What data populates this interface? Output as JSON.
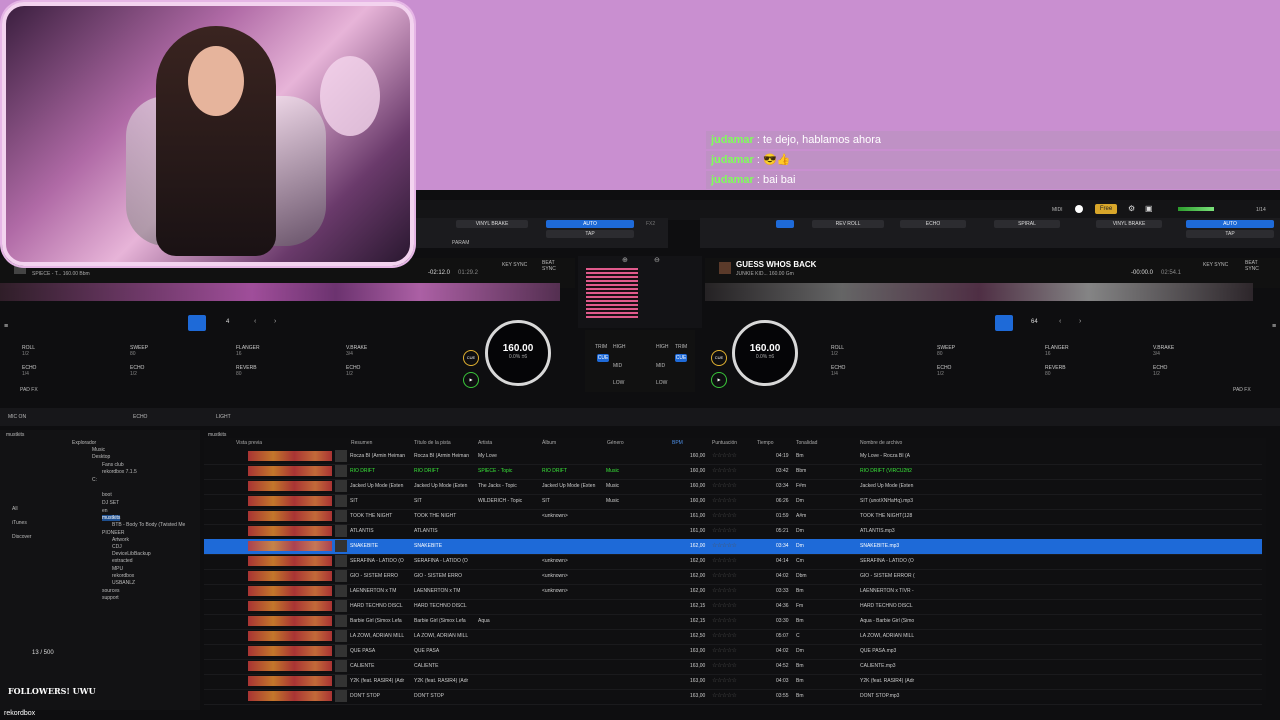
{
  "chat": [
    {
      "user": "judamar",
      "message": ": te dejo, hablamos ahora"
    },
    {
      "user": "judamar",
      "message": ": 😎👍"
    },
    {
      "user": "judamar",
      "message": ": bai bai"
    }
  ],
  "topbar": {
    "midi": "MIDI",
    "free": "Free",
    "page": "1/14"
  },
  "fx_left": {
    "brake": "VINYL BRAKE",
    "auto": "AUTO",
    "tap": "TAP",
    "param": "PARAM",
    "fx2": "FX2"
  },
  "fx_right": {
    "revroll": "REV ROLL",
    "echo": "ECHO",
    "spiral": "SPIRAL",
    "brake": "VINYL BRAKE",
    "auto": "AUTO",
    "tap": "TAP"
  },
  "deck1": {
    "title": "RIO DRIFT",
    "sub": "SPIECE - T... 160.00 Bbm",
    "time": "-02:12.0",
    "total": "01:29.2",
    "key_sync": "KEY SYNC",
    "beat_sync": "BEAT SYNC",
    "bpm": "160.00",
    "pct": "0.0% ±6",
    "quant": "4",
    "pads": [
      {
        "label": "ROLL",
        "val": "1/2"
      },
      {
        "label": "SWEEP",
        "val": "80"
      },
      {
        "label": "FLANGER",
        "val": "16"
      },
      {
        "label": "V.BRAKE",
        "val": "3/4"
      },
      {
        "label": "ECHO",
        "val": "1/4"
      },
      {
        "label": "ECHO",
        "val": "1/2"
      },
      {
        "label": "REVERB",
        "val": "80"
      },
      {
        "label": "ECHO",
        "val": "1/2"
      }
    ],
    "cue": "CUE",
    "padfx": "PAD FX"
  },
  "deck2": {
    "title": "GUESS WHOS BACK",
    "sub": "JUNKIE KID... 160.00 Gm",
    "time": "-00:00.0",
    "total": "02:54.1",
    "key_sync": "KEY SYNC",
    "beat_sync": "BEAT SYNC",
    "bpm": "160.00",
    "pct": "0.0% ±6",
    "quant": "64",
    "pads": [
      {
        "label": "ROLL",
        "val": "1/2"
      },
      {
        "label": "SWEEP",
        "val": "80"
      },
      {
        "label": "FLANGER",
        "val": "16"
      },
      {
        "label": "V.BRAKE",
        "val": "3/4"
      },
      {
        "label": "ECHO",
        "val": "1/4"
      },
      {
        "label": "ECHO",
        "val": "1/2"
      },
      {
        "label": "REVERB",
        "val": "80"
      },
      {
        "label": "ECHO",
        "val": "1/2"
      }
    ],
    "cue": "CUE",
    "padfx": "PAD FX"
  },
  "mixer": {
    "trim": "TRIM",
    "high": "HIGH",
    "mid": "MID",
    "low": "LOW",
    "cue": "CUE"
  },
  "micbar": {
    "mic": "MIC ON",
    "echo": "ECHO",
    "light": "LIGHT"
  },
  "browser": {
    "path": "mustkits",
    "sidebar": [
      "mustkits",
      "All",
      "iTunes",
      "Discover"
    ],
    "tree": [
      "Explorador",
      "Music",
      "Desktop",
      "Fans club",
      "rekordbox 7.1.5",
      "C:",
      "boot",
      "DJ SET",
      "en",
      "mustkits",
      "BTB - Body To Body (Twisted Me",
      "PIONEER",
      "Artwork",
      "CDJ",
      "DeviceLibBackup",
      "extracted",
      "MPU",
      "rekordbox",
      "USBANLZ",
      "sources",
      "support"
    ],
    "columns": [
      "Vista previa",
      "Resumen",
      "Título de la pista",
      "Artista",
      "Álbum",
      "Género",
      "BPM",
      "Puntuación",
      "Tiempo",
      "Tonalidad",
      "Nombre de archivo"
    ],
    "rows": [
      {
        "summary": "Rocza BI (Armin Heiman",
        "title": "Rocza BI (Armin Heiman",
        "artist": "My Love",
        "album": "",
        "genre": "",
        "bpm": "160,00",
        "time": "04:19",
        "key": "Bm",
        "file": "My Love - Rocza BI (A"
      },
      {
        "summary": "RIO DRIFT",
        "title": "RIO DRIFT",
        "artist": "SPIECE - Topic",
        "album": "RIO DRIFT",
        "genre": "Music",
        "bpm": "160,00",
        "time": "03:42",
        "key": "Bbm",
        "file": "RIO DRIFT (VIRCU2ft2"
      },
      {
        "summary": "Jacked Up Mode (Exten",
        "title": "Jacked Up Mode (Exten",
        "artist": "The Jacks - Topic",
        "album": "Jacked Up Mode (Exten",
        "genre": "Music",
        "bpm": "160,00",
        "time": "03:34",
        "key": "F#m",
        "file": "Jacked Up Mode (Exten"
      },
      {
        "summary": "SIT",
        "title": "SIT",
        "artist": "WILDERICH - Topic",
        "album": "SIT",
        "genre": "Music",
        "bpm": "160,00",
        "time": "06:26",
        "key": "Dm",
        "file": "SIT (unotXNHaHq).mp3"
      },
      {
        "summary": "TOOK THE NIGHT",
        "title": "TOOK THE NIGHT",
        "artist": "",
        "album": "<unknown>",
        "genre": "",
        "bpm": "161,00",
        "time": "01:59",
        "key": "A#m",
        "file": "TOOK THE NIGHT(128"
      },
      {
        "summary": "ATLANTIS",
        "title": "ATLANTIS",
        "artist": "",
        "album": "",
        "genre": "",
        "bpm": "161,00",
        "time": "05:21",
        "key": "Dm",
        "file": "ATLANTIS.mp3"
      },
      {
        "summary": "SNAKEBITE",
        "title": "SNAKEBITE",
        "artist": "",
        "album": "",
        "genre": "",
        "bpm": "162,00",
        "time": "03:34",
        "key": "Dm",
        "file": "SNAKEBITE.mp3"
      },
      {
        "summary": "SERAFINA - LATIDO (O",
        "title": "SERAFINA - LATIDO (O",
        "artist": "",
        "album": "<unknown>",
        "genre": "",
        "bpm": "162,00",
        "time": "04:14",
        "key": "Cm",
        "file": "SERAFINA - LATIDO (O"
      },
      {
        "summary": "GIO - SISTEM ERRO",
        "title": "GIO - SISTEM ERRO",
        "artist": "",
        "album": "<unknown>",
        "genre": "",
        "bpm": "162,00",
        "time": "04:02",
        "key": "Dbm",
        "file": "GIO - SISTEM ERROR ("
      },
      {
        "summary": "LAENNERTON x TM",
        "title": "LAENNERTON x TM",
        "artist": "",
        "album": "<unknown>",
        "genre": "",
        "bpm": "162,00",
        "time": "03:33",
        "key": "Bm",
        "file": "LAENNERTON x TIVR -"
      },
      {
        "summary": "HARD TECHNO DISCL",
        "title": "HARD TECHNO DISCL",
        "artist": "",
        "album": "",
        "genre": "",
        "bpm": "162,15",
        "time": "04:36",
        "key": "Fm",
        "file": "HARD TECHNO DISCL"
      },
      {
        "summary": "Barbie Girl (Simox Lefa",
        "title": "Barbie Girl (Simox Lefa",
        "artist": "Aqua",
        "album": "",
        "genre": "",
        "bpm": "162,15",
        "time": "03:30",
        "key": "Bm",
        "file": "Aqua - Barbie Girl (Simo"
      },
      {
        "summary": "LA ZOWI, ADRIÁN MILL",
        "title": "LA ZOWI, ADRIÁN MILL",
        "artist": "",
        "album": "",
        "genre": "",
        "bpm": "162,50",
        "time": "05:07",
        "key": "C",
        "file": "LA ZOWI, ADRIÁN MILL"
      },
      {
        "summary": "QUE PASA",
        "title": "QUE PASA",
        "artist": "",
        "album": "",
        "genre": "",
        "bpm": "163,00",
        "time": "04:02",
        "key": "Dm",
        "file": "QUE PASA.mp3"
      },
      {
        "summary": "CALIENTE",
        "title": "CALIENTE",
        "artist": "",
        "album": "",
        "genre": "",
        "bpm": "163,00",
        "time": "04:52",
        "key": "Bm",
        "file": "CALIENTE.mp3"
      },
      {
        "summary": "Y2K (feat. RASIR4) (Adr",
        "title": "Y2K (feat. RASIR4) (Adr",
        "artist": "",
        "album": "",
        "genre": "",
        "bpm": "163,00",
        "time": "04:03",
        "key": "Bm",
        "file": "Y2K (feat. RASIR4) (Adr"
      },
      {
        "summary": "DON'T STOP",
        "title": "DON'T STOP",
        "artist": "",
        "album": "",
        "genre": "",
        "bpm": "163,00",
        "time": "03:55",
        "key": "Bm",
        "file": "DONT STOP.mp3"
      }
    ],
    "selected_row": 6,
    "green_row": 1
  },
  "overlay": {
    "counter": "13 / 500",
    "followers": "FOLLOWERS! UWU",
    "brand": "rekordbox"
  },
  "colors": {
    "accent": "#1e6ad8",
    "bg": "#0e0e10",
    "stream_bg": "#c98fd0",
    "chat_user": "#7fff5a"
  }
}
